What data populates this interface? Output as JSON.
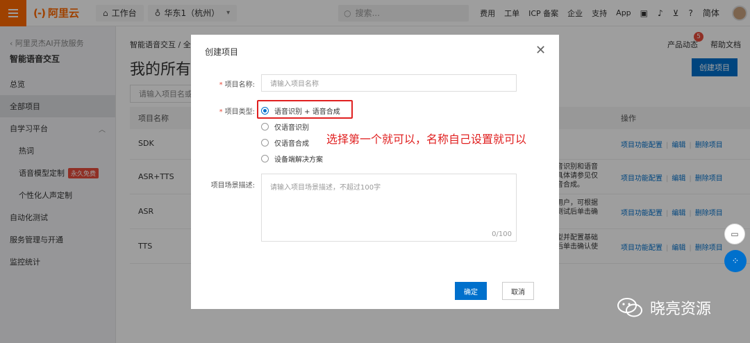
{
  "topbar": {
    "logo_text": "阿里云",
    "workbench": "工作台",
    "region": "华东1（杭州）",
    "search_placeholder": "搜索...",
    "links": [
      "费用",
      "工单",
      "ICP 备案",
      "企业",
      "支持",
      "App"
    ],
    "lang": "简体"
  },
  "sidebar": {
    "back_label": "阿里灵杰AI开放服务",
    "title": "智能语音交互",
    "items": [
      {
        "label": "总览"
      },
      {
        "label": "全部项目"
      },
      {
        "label": "自学习平台"
      },
      {
        "label": "热词"
      },
      {
        "label": "语音模型定制",
        "badge": "永久免费"
      },
      {
        "label": "个性化人声定制"
      },
      {
        "label": "自动化测试"
      },
      {
        "label": "服务管理与开通"
      },
      {
        "label": "监控统计"
      }
    ]
  },
  "main": {
    "breadcrumb": "智能语音交互 / 全部",
    "title": "我的所有",
    "product_news": "产品动态",
    "notif_count": "5",
    "help_doc": "帮助文档",
    "create_button": "创建项目",
    "search_placeholder": "请输入项目名或ap",
    "table": {
      "col_name": "项目名称",
      "col_ops": "操作",
      "rows": [
        {
          "name": "SDK",
          "desc": ""
        },
        {
          "name": "ASR+TTS",
          "desc": "音识别和语音 具体请参见仅 音合成。"
        },
        {
          "name": "ASR",
          "desc": "用户，可根据 测试后单击确"
        },
        {
          "name": "TTS",
          "desc": "型并配置基础 后单击确认使"
        }
      ],
      "op_config": "项目功能配置",
      "op_edit": "编辑",
      "op_delete": "删除项目"
    }
  },
  "modal": {
    "title": "创建项目",
    "name_label": "项目名称:",
    "name_placeholder": "请输入项目名称",
    "type_label": "项目类型:",
    "type_options": [
      "语音识别 + 语音合成",
      "仅语音识别",
      "仅语音合成",
      "设备端解决方案"
    ],
    "desc_label": "项目场景描述:",
    "desc_placeholder": "请输入项目场景描述，不超过100字",
    "desc_count": "0/100",
    "ok_button": "确定",
    "cancel_button": "取消"
  },
  "annotation": "选择第一个就可以，名称自己设置就可以",
  "watermark": "晓亮资源",
  "colors": {
    "brand": "#ff6a00",
    "primary": "#0070cc",
    "annotation": "#e02020"
  }
}
